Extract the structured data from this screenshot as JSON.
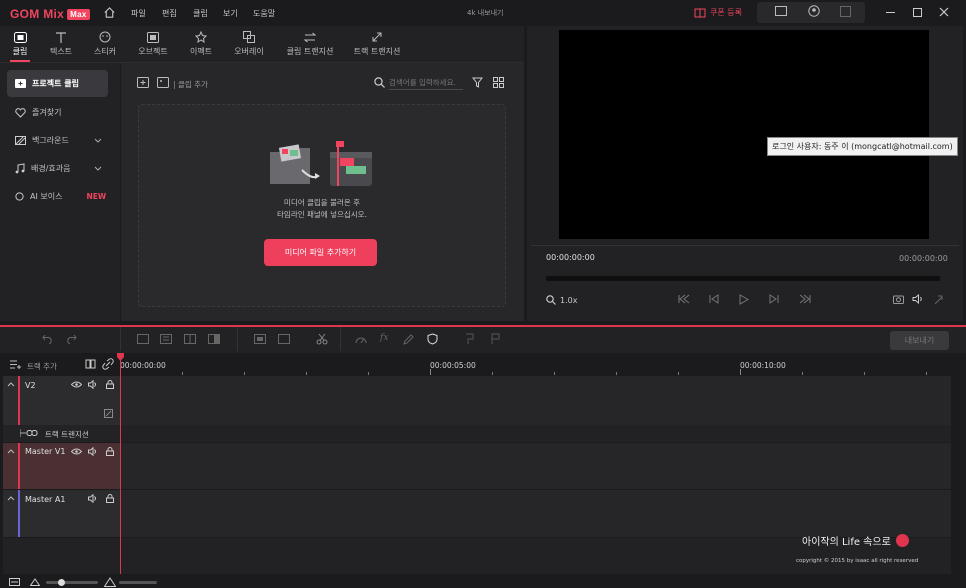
{
  "app": {
    "logo": "GOM Mix",
    "badge": "Max",
    "center_title": "4k 내보내기",
    "coupon": "쿠폰 등록"
  },
  "menu": [
    "파일",
    "편집",
    "클립",
    "보기",
    "도움말"
  ],
  "tabs": [
    {
      "label": "클립",
      "icon": "clip-icon"
    },
    {
      "label": "텍스트",
      "icon": "text-icon"
    },
    {
      "label": "스티커",
      "icon": "sticker-icon"
    },
    {
      "label": "오브젝트",
      "icon": "object-icon"
    },
    {
      "label": "이펙트",
      "icon": "effect-icon"
    },
    {
      "label": "오버레이",
      "icon": "overlay-icon"
    },
    {
      "label": "클립 트랜지션",
      "icon": "clip-transition-icon"
    },
    {
      "label": "트랙 트랜지션",
      "icon": "track-transition-icon"
    }
  ],
  "sidebar": [
    {
      "label": "프로젝트 클립",
      "icon": "add-clip-icon"
    },
    {
      "label": "즐겨찾기",
      "icon": "heart-icon"
    },
    {
      "label": "백그라운드",
      "icon": "background-icon"
    },
    {
      "label": "배경/효과음",
      "icon": "music-icon"
    },
    {
      "label": "AI 보이스",
      "icon": "ai-voice-icon",
      "badge": "NEW"
    }
  ],
  "media": {
    "add_clip": "클립 추가",
    "search_placeholder": "검색어를 입력하세요.",
    "empty_line1": "미디어 클립을 불러온 후",
    "empty_line2": "타임라인 패널에 넣으십시오.",
    "add_button": "미디어 파일 추가하기"
  },
  "preview": {
    "tooltip": "로그인 사용자: 동주 이 (mongcatl@hotmail.com)",
    "time_current": "00:00:00:00",
    "time_total": "00:00:00:00",
    "zoom": "1.0x"
  },
  "timeline": {
    "export_button": "내보내기",
    "add_track": "트랙 추가",
    "ruler": [
      "00:00:00:00",
      "00:00:05:00",
      "00:00:10:00"
    ],
    "tracks": {
      "v2": "V2",
      "transition": "트랙 트랜지션",
      "master_v1": "Master V1",
      "master_a1": "Master A1"
    }
  },
  "watermark": {
    "line1": "아이작의 Life 속으로",
    "line2": "copyright © 2015 by isaac all right reserved"
  },
  "colors": {
    "accent": "#ee3f5c",
    "tooltip_bg": "#f1f1f1",
    "audio_track": "#6b63d8"
  }
}
